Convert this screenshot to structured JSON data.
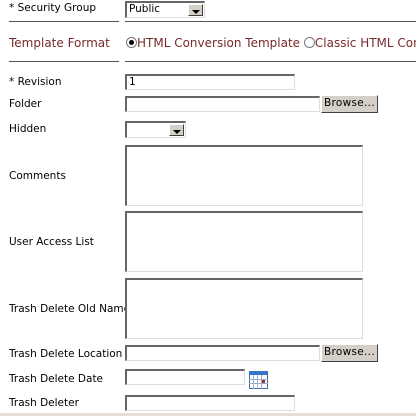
{
  "security_group": {
    "label": "* Security Group",
    "value": "Public"
  },
  "template_format": {
    "label": "Template Format",
    "options": [
      {
        "label": "HTML Conversion Template",
        "selected": true
      },
      {
        "label": "Classic HTML Conv",
        "selected": false
      }
    ]
  },
  "revision": {
    "label": "* Revision",
    "value": "1"
  },
  "folder": {
    "label": "Folder",
    "value": "",
    "browse": "Browse..."
  },
  "hidden": {
    "label": "Hidden",
    "value": ""
  },
  "comments": {
    "label": "Comments",
    "value": ""
  },
  "user_access_list": {
    "label": "User Access List",
    "value": ""
  },
  "trash_delete_old_name": {
    "label": "Trash Delete Old Name",
    "value": ""
  },
  "trash_delete_location": {
    "label": "Trash Delete Location",
    "value": "",
    "browse": "Browse..."
  },
  "trash_delete_date": {
    "label": "Trash Delete Date",
    "value": ""
  },
  "trash_deleter": {
    "label": "Trash Deleter",
    "value": ""
  }
}
